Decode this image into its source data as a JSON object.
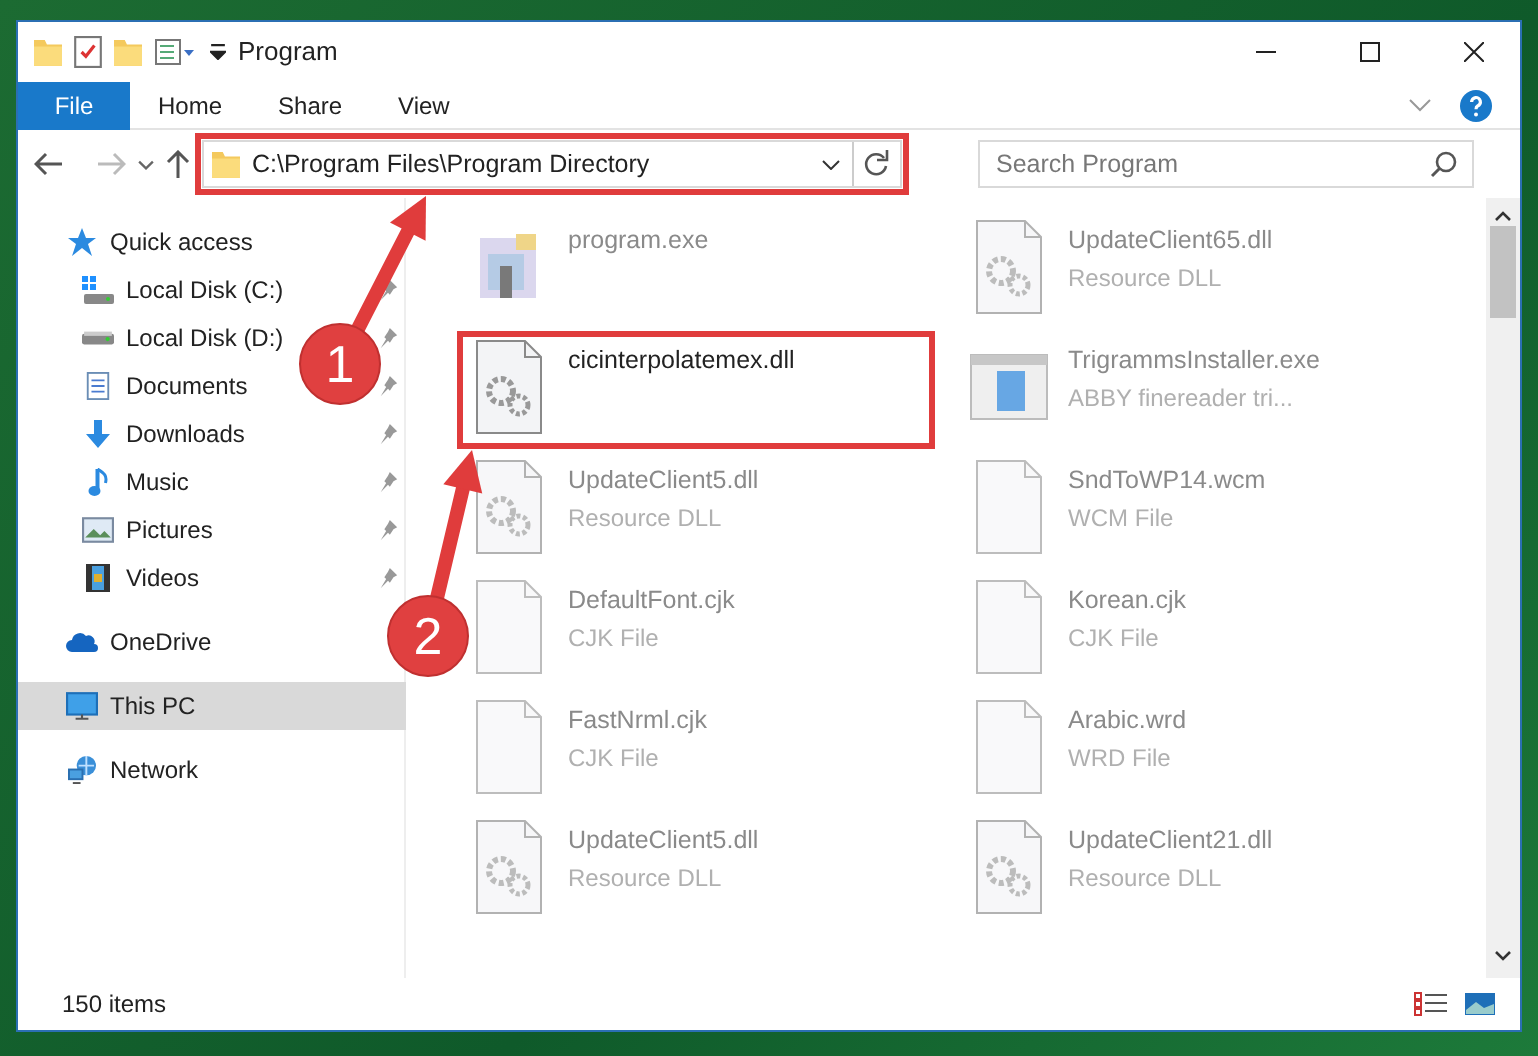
{
  "window": {
    "title": "Program"
  },
  "ribbon_tabs": [
    {
      "label": "File",
      "selected": true
    },
    {
      "label": "Home",
      "selected": false
    },
    {
      "label": "Share",
      "selected": false
    },
    {
      "label": "View",
      "selected": false
    }
  ],
  "address": {
    "path": "C:\\Program Files\\Program Directory"
  },
  "search": {
    "placeholder": "Search Program"
  },
  "sidebar": {
    "groups": [
      {
        "items": [
          {
            "label": "Quick access",
            "kind": "star",
            "pinned": false,
            "selected": false,
            "children": [
              {
                "label": "Local Disk (C:)",
                "kind": "system-drive",
                "pinned": true,
                "selected": false
              },
              {
                "label": "Local Disk (D:)",
                "kind": "drive",
                "pinned": true,
                "selected": false
              },
              {
                "label": "Documents",
                "kind": "documents",
                "pinned": true,
                "selected": false
              },
              {
                "label": "Downloads",
                "kind": "downloads",
                "pinned": true,
                "selected": false
              },
              {
                "label": "Music",
                "kind": "music",
                "pinned": true,
                "selected": false
              },
              {
                "label": "Pictures",
                "kind": "pictures",
                "pinned": true,
                "selected": false
              },
              {
                "label": "Videos",
                "kind": "videos",
                "pinned": true,
                "selected": false
              }
            ]
          }
        ]
      },
      {
        "items": [
          {
            "label": "OneDrive",
            "kind": "cloud",
            "pinned": false,
            "selected": false
          }
        ]
      },
      {
        "items": [
          {
            "label": "This PC",
            "kind": "computer",
            "pinned": false,
            "selected": true
          }
        ]
      },
      {
        "items": [
          {
            "label": "Network",
            "kind": "network",
            "pinned": false,
            "selected": false
          }
        ]
      }
    ]
  },
  "files": [
    {
      "name": "program.exe",
      "kind": "app",
      "dimmed": true,
      "highlighted": false
    },
    {
      "name": "UpdateClient65.dll",
      "type": "Resource DLL",
      "kind": "dll",
      "dimmed": true,
      "highlighted": false
    },
    {
      "name": "cicinterpolatemex.dll",
      "kind": "dll",
      "dimmed": false,
      "highlighted": true
    },
    {
      "name": "TrigrammsInstaller.exe",
      "type": "ABBY finereader tri...",
      "kind": "installer",
      "dimmed": true,
      "highlighted": false
    },
    {
      "name": "UpdateClient5.dll",
      "type": "Resource DLL",
      "kind": "dll",
      "dimmed": true,
      "highlighted": false
    },
    {
      "name": "SndToWP14.wcm",
      "type": "WCM File",
      "kind": "blank",
      "dimmed": true,
      "highlighted": false
    },
    {
      "name": "DefaultFont.cjk",
      "type": "CJK File",
      "kind": "blank",
      "dimmed": true,
      "highlighted": false
    },
    {
      "name": "Korean.cjk",
      "type": "CJK File",
      "kind": "blank",
      "dimmed": true,
      "highlighted": false
    },
    {
      "name": "FastNrml.cjk",
      "type": "CJK File",
      "kind": "blank",
      "dimmed": true,
      "highlighted": false
    },
    {
      "name": "Arabic.wrd",
      "type": "WRD File",
      "kind": "blank",
      "dimmed": true,
      "highlighted": false
    },
    {
      "name": "UpdateClient5.dll",
      "type": "Resource DLL",
      "kind": "dll",
      "dimmed": true,
      "highlighted": false
    },
    {
      "name": "UpdateClient21.dll",
      "type": "Resource DLL",
      "kind": "dll",
      "dimmed": true,
      "highlighted": false
    }
  ],
  "status_bar": {
    "count": "150 items"
  },
  "callouts": [
    {
      "number": "1"
    },
    {
      "number": "2"
    }
  ]
}
